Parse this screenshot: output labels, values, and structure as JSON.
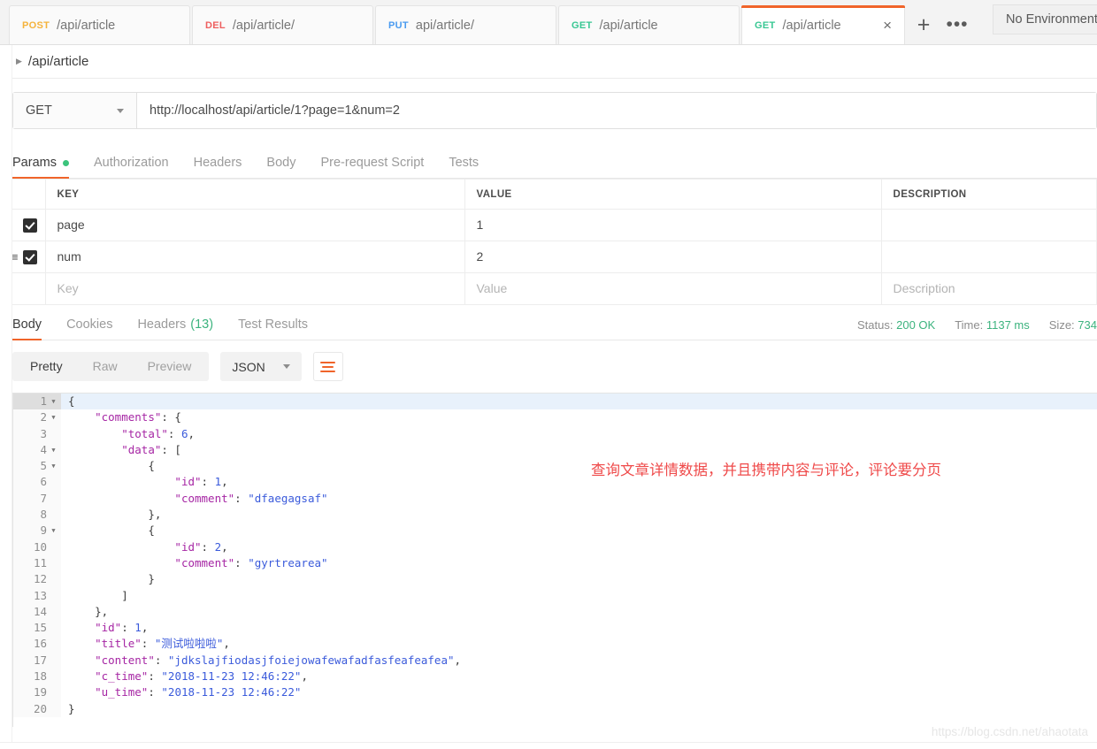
{
  "tabbar": {
    "tabs": [
      {
        "method": "POST",
        "name": "/api/article",
        "active": false
      },
      {
        "method": "DEL",
        "name": "/api/article/",
        "active": false
      },
      {
        "method": "PUT",
        "name": "api/article/",
        "active": false
      },
      {
        "method": "GET",
        "name": "/api/article",
        "active": false
      },
      {
        "method": "GET",
        "name": "/api/article",
        "active": true
      }
    ],
    "close_label": "×",
    "new_tab_label": "+",
    "more_label": "•••",
    "environment": "No Environment"
  },
  "breadcrumb": {
    "arrow": "▶",
    "text": "/api/article"
  },
  "request": {
    "method": "GET",
    "url": "http://localhost/api/article/1?page=1&num=2",
    "tabs": [
      {
        "label": "Params",
        "active": true,
        "dot": true
      },
      {
        "label": "Authorization",
        "active": false,
        "dot": false
      },
      {
        "label": "Headers",
        "active": false,
        "dot": false
      },
      {
        "label": "Body",
        "active": false,
        "dot": false
      },
      {
        "label": "Pre-request Script",
        "active": false,
        "dot": false
      },
      {
        "label": "Tests",
        "active": false,
        "dot": false
      }
    ]
  },
  "params": {
    "headers": {
      "key": "KEY",
      "value": "VALUE",
      "description": "DESCRIPTION"
    },
    "rows": [
      {
        "checked": true,
        "handle": false,
        "key": "page",
        "value": "1",
        "description": ""
      },
      {
        "checked": true,
        "handle": true,
        "key": "num",
        "value": "2",
        "description": ""
      }
    ],
    "placeholder_row": {
      "key": "Key",
      "value": "Value",
      "description": "Description"
    }
  },
  "response": {
    "tabs": [
      {
        "label": "Body",
        "active": true,
        "count": ""
      },
      {
        "label": "Cookies",
        "active": false,
        "count": ""
      },
      {
        "label": "Headers",
        "active": false,
        "count": "(13)"
      },
      {
        "label": "Test Results",
        "active": false,
        "count": ""
      }
    ],
    "status_label": "Status:",
    "status_value": "200 OK",
    "time_label": "Time:",
    "time_value": "1137 ms",
    "size_label": "Size:",
    "size_value": "734",
    "format_tabs": [
      {
        "label": "Pretty",
        "active": true
      },
      {
        "label": "Raw",
        "active": false
      },
      {
        "label": "Preview",
        "active": false
      }
    ],
    "language": "JSON",
    "body_lines": [
      {
        "num": "1",
        "fold": true,
        "indent": 0,
        "parts": [
          [
            "p",
            "{"
          ]
        ]
      },
      {
        "num": "2",
        "fold": true,
        "indent": 1,
        "parts": [
          [
            "k",
            "\"comments\""
          ],
          [
            "p",
            ": {"
          ]
        ]
      },
      {
        "num": "3",
        "fold": false,
        "indent": 2,
        "parts": [
          [
            "k",
            "\"total\""
          ],
          [
            "p",
            ": "
          ],
          [
            "n",
            "6"
          ],
          [
            "p",
            ","
          ]
        ]
      },
      {
        "num": "4",
        "fold": true,
        "indent": 2,
        "parts": [
          [
            "k",
            "\"data\""
          ],
          [
            "p",
            ": ["
          ]
        ]
      },
      {
        "num": "5",
        "fold": true,
        "indent": 3,
        "parts": [
          [
            "p",
            "{"
          ]
        ]
      },
      {
        "num": "6",
        "fold": false,
        "indent": 4,
        "parts": [
          [
            "k",
            "\"id\""
          ],
          [
            "p",
            ": "
          ],
          [
            "n",
            "1"
          ],
          [
            "p",
            ","
          ]
        ]
      },
      {
        "num": "7",
        "fold": false,
        "indent": 4,
        "parts": [
          [
            "k",
            "\"comment\""
          ],
          [
            "p",
            ": "
          ],
          [
            "s",
            "\"dfaegagsaf\""
          ]
        ]
      },
      {
        "num": "8",
        "fold": false,
        "indent": 3,
        "parts": [
          [
            "p",
            "},"
          ]
        ]
      },
      {
        "num": "9",
        "fold": true,
        "indent": 3,
        "parts": [
          [
            "p",
            "{"
          ]
        ]
      },
      {
        "num": "10",
        "fold": false,
        "indent": 4,
        "parts": [
          [
            "k",
            "\"id\""
          ],
          [
            "p",
            ": "
          ],
          [
            "n",
            "2"
          ],
          [
            "p",
            ","
          ]
        ]
      },
      {
        "num": "11",
        "fold": false,
        "indent": 4,
        "parts": [
          [
            "k",
            "\"comment\""
          ],
          [
            "p",
            ": "
          ],
          [
            "s",
            "\"gyrtrearea\""
          ]
        ]
      },
      {
        "num": "12",
        "fold": false,
        "indent": 3,
        "parts": [
          [
            "p",
            "}"
          ]
        ]
      },
      {
        "num": "13",
        "fold": false,
        "indent": 2,
        "parts": [
          [
            "p",
            "]"
          ]
        ]
      },
      {
        "num": "14",
        "fold": false,
        "indent": 1,
        "parts": [
          [
            "p",
            "},"
          ]
        ]
      },
      {
        "num": "15",
        "fold": false,
        "indent": 1,
        "parts": [
          [
            "k",
            "\"id\""
          ],
          [
            "p",
            ": "
          ],
          [
            "n",
            "1"
          ],
          [
            "p",
            ","
          ]
        ]
      },
      {
        "num": "16",
        "fold": false,
        "indent": 1,
        "parts": [
          [
            "k",
            "\"title\""
          ],
          [
            "p",
            ": "
          ],
          [
            "s",
            "\"测试啦啦啦\""
          ],
          [
            "p",
            ","
          ]
        ]
      },
      {
        "num": "17",
        "fold": false,
        "indent": 1,
        "parts": [
          [
            "k",
            "\"content\""
          ],
          [
            "p",
            ": "
          ],
          [
            "s",
            "\"jdkslajfiodasjfoiejowafewafadfasfeafeafea\""
          ],
          [
            "p",
            ","
          ]
        ]
      },
      {
        "num": "18",
        "fold": false,
        "indent": 1,
        "parts": [
          [
            "k",
            "\"c_time\""
          ],
          [
            "p",
            ": "
          ],
          [
            "s",
            "\"2018-11-23 12:46:22\""
          ],
          [
            "p",
            ","
          ]
        ]
      },
      {
        "num": "19",
        "fold": false,
        "indent": 1,
        "parts": [
          [
            "k",
            "\"u_time\""
          ],
          [
            "p",
            ": "
          ],
          [
            "s",
            "\"2018-11-23 12:46:22\""
          ]
        ]
      },
      {
        "num": "20",
        "fold": false,
        "indent": 0,
        "parts": [
          [
            "p",
            "}"
          ]
        ]
      }
    ]
  },
  "annotation": "查询文章详情数据，并且携带内容与评论，评论要分页",
  "watermark": "https://blog.csdn.net/ahaotata",
  "colors": {
    "accent": "#f0642a",
    "success": "#3cb37e",
    "method_post": "#f5b33c",
    "method_del": "#ee5f5f",
    "method_put": "#4a9bf0",
    "method_get": "#38c793",
    "annotation": "#ef4a4a"
  }
}
